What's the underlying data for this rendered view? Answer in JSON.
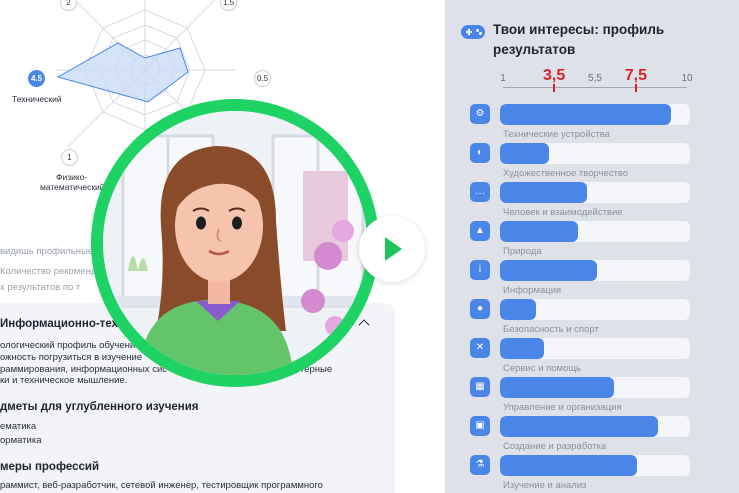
{
  "left_panel": {
    "radar": {
      "axes": [
        {
          "label": "Технический",
          "value": "4.5",
          "active": true
        },
        {
          "label": "Физико-математический",
          "value": "1"
        },
        {
          "top_left_value": "2"
        },
        {
          "top_right_value": "1.5"
        },
        {
          "right_value": "0.5"
        }
      ],
      "label_technical": "Технический",
      "label_physmath_1": "Физико-",
      "label_physmath_2": "математический",
      "value_technical": "4.5",
      "value_physmath": "1",
      "value_top_left": "2",
      "value_top_right": "1.5",
      "value_right": "0.5"
    },
    "hint": {
      "line1": "видишь профильные",
      "line2": "Количество рекоменд",
      "line3": "х результатов по т"
    },
    "profile_card": {
      "title": "Информационно-техн",
      "desc_line1": "ологический профиль обучени",
      "desc_line2": "ожность погрузиться в изучение",
      "desc_line3": "раммирования, информационных сис",
      "desc_line3_tail": "терные",
      "desc_line4": "ки и техническое мышление.",
      "subjects_title": "дметы для углубленного изучения",
      "subject1": "ематика",
      "subject2": "орматика",
      "professions_title": "меры профессий",
      "professions_text": "раммист, веб-разработчик, сетевой инженер, тестировщик программного"
    }
  },
  "right_panel": {
    "title": "Твои интересы: профиль результатов",
    "scale": {
      "labels": [
        "1",
        "3,5",
        "5,5",
        "7,5",
        "10"
      ],
      "highlighted": [
        "3,5",
        "7,5"
      ],
      "accent_color": "#d8232a"
    },
    "rows": [
      {
        "label": "Технические устройства",
        "icon": "gear-icon",
        "fraction": 0.9
      },
      {
        "label": "Художественное творчество",
        "icon": "palette-icon",
        "fraction": 0.26
      },
      {
        "label": "Человек и взаимодействие",
        "icon": "chat-icon",
        "fraction": 0.46
      },
      {
        "label": "Природа",
        "icon": "landscape-icon",
        "fraction": 0.41
      },
      {
        "label": "Информация",
        "icon": "info-icon",
        "fraction": 0.51
      },
      {
        "label": "Безопасность и спорт",
        "icon": "ball-icon",
        "fraction": 0.19
      },
      {
        "label": "Сервис и помощь",
        "icon": "tools-icon",
        "fraction": 0.23
      },
      {
        "label": "Управление и организация",
        "icon": "calendar-icon",
        "fraction": 0.6
      },
      {
        "label": "Создание и разработка",
        "icon": "layers-icon",
        "fraction": 0.83
      },
      {
        "label": "Изучение и анализ",
        "icon": "flask-icon",
        "fraction": 0.72
      }
    ],
    "bar_color": "#4a86e8"
  },
  "video": {
    "ring_color": "#1fd264",
    "play_icon": "play-icon"
  }
}
